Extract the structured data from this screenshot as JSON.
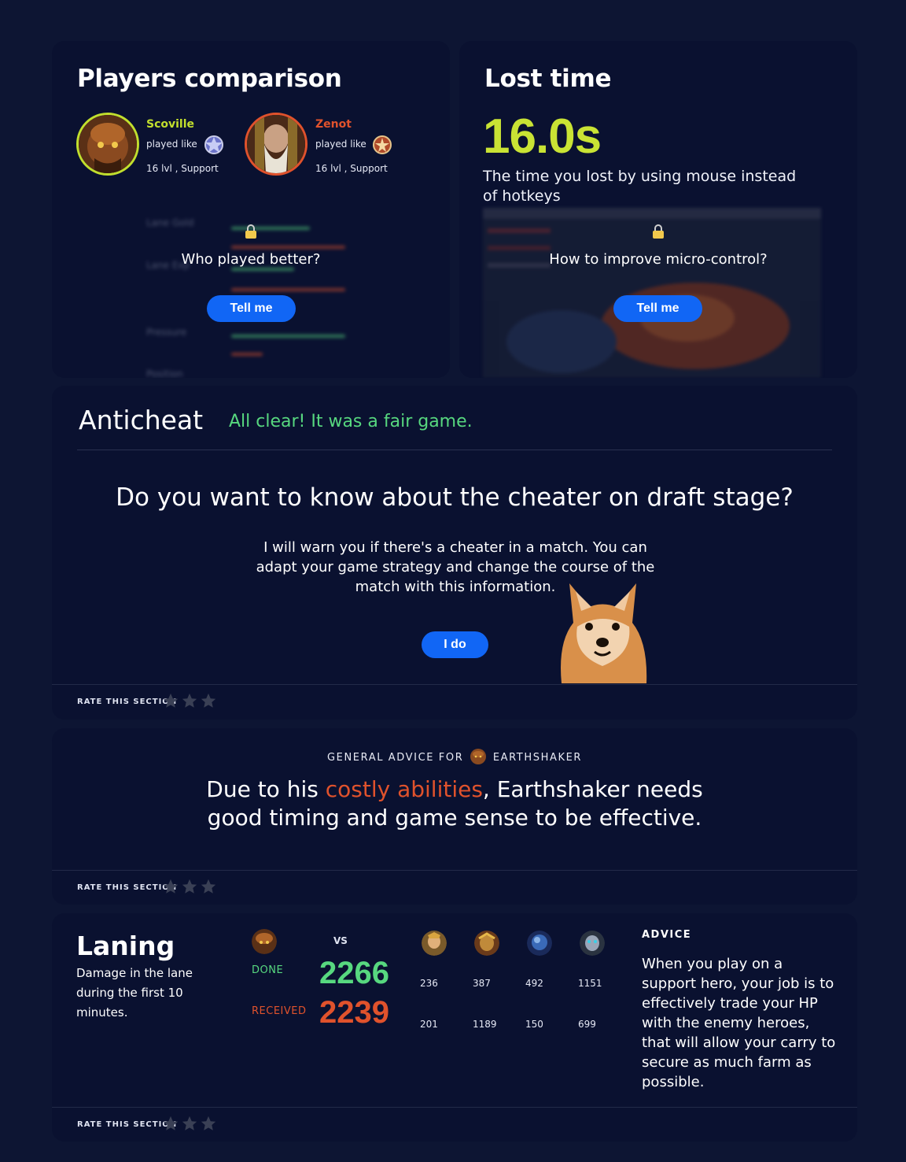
{
  "players_comparison": {
    "title": "Players comparison",
    "player1": {
      "name": "Scoville",
      "played_like": "played like",
      "info": "16 lvl , Support",
      "name_color": "#c2df2d"
    },
    "player2": {
      "name": "Zenot",
      "played_like": "played like",
      "info": "16 lvl , Support",
      "name_color": "#e0522c"
    },
    "locked_question": "Who played better?",
    "button": "Tell me",
    "blurred_labels": [
      "Lane Gold",
      "Lane Exp",
      "Pressure",
      "Position"
    ]
  },
  "lost_time": {
    "title": "Lost time",
    "value": "16.0s",
    "description": "The time you lost by using mouse instead of hotkeys",
    "locked_question": "How to improve micro-control?",
    "button": "Tell me"
  },
  "anticheat": {
    "title": "Anticheat",
    "status": "All clear! It was a fair game.",
    "question": "Do you want to know about the cheater on draft stage?",
    "description": "I will warn you if there's a cheater in a match. You can adapt your game strategy and change the course of the match with this information.",
    "button": "I do",
    "rate_label": "RATE  THIS SECTION"
  },
  "general_advice": {
    "header_prefix": "GENERAL ADVICE FOR",
    "hero": "EARTHSHAKER",
    "text_before": "Due to his ",
    "text_accent": "costly abilities",
    "text_after": ", Earthshaker needs good timing and game sense to be effective.",
    "rate_label": "RATE  THIS SECTION"
  },
  "laning": {
    "title": "Laning",
    "description": "Damage in the lane during the first 10 minutes.",
    "vs": "VS",
    "done_label": "DONE",
    "received_label": "RECEIVED",
    "done_value": "2266",
    "received_value": "2239",
    "enemies": [
      {
        "icon": "hero-icon-1",
        "done": "236",
        "received": "201"
      },
      {
        "icon": "hero-icon-2",
        "done": "387",
        "received": "1189"
      },
      {
        "icon": "hero-icon-3",
        "done": "492",
        "received": "150"
      },
      {
        "icon": "hero-icon-4",
        "done": "1151",
        "received": "699"
      }
    ],
    "advice_heading": "ADVICE",
    "advice_text": "When you play on a support hero, your job is to effectively trade your HP with the enemy heroes, that will allow your carry to secure as much farm as possible.",
    "rate_label": "RATE  THIS SECTION"
  }
}
